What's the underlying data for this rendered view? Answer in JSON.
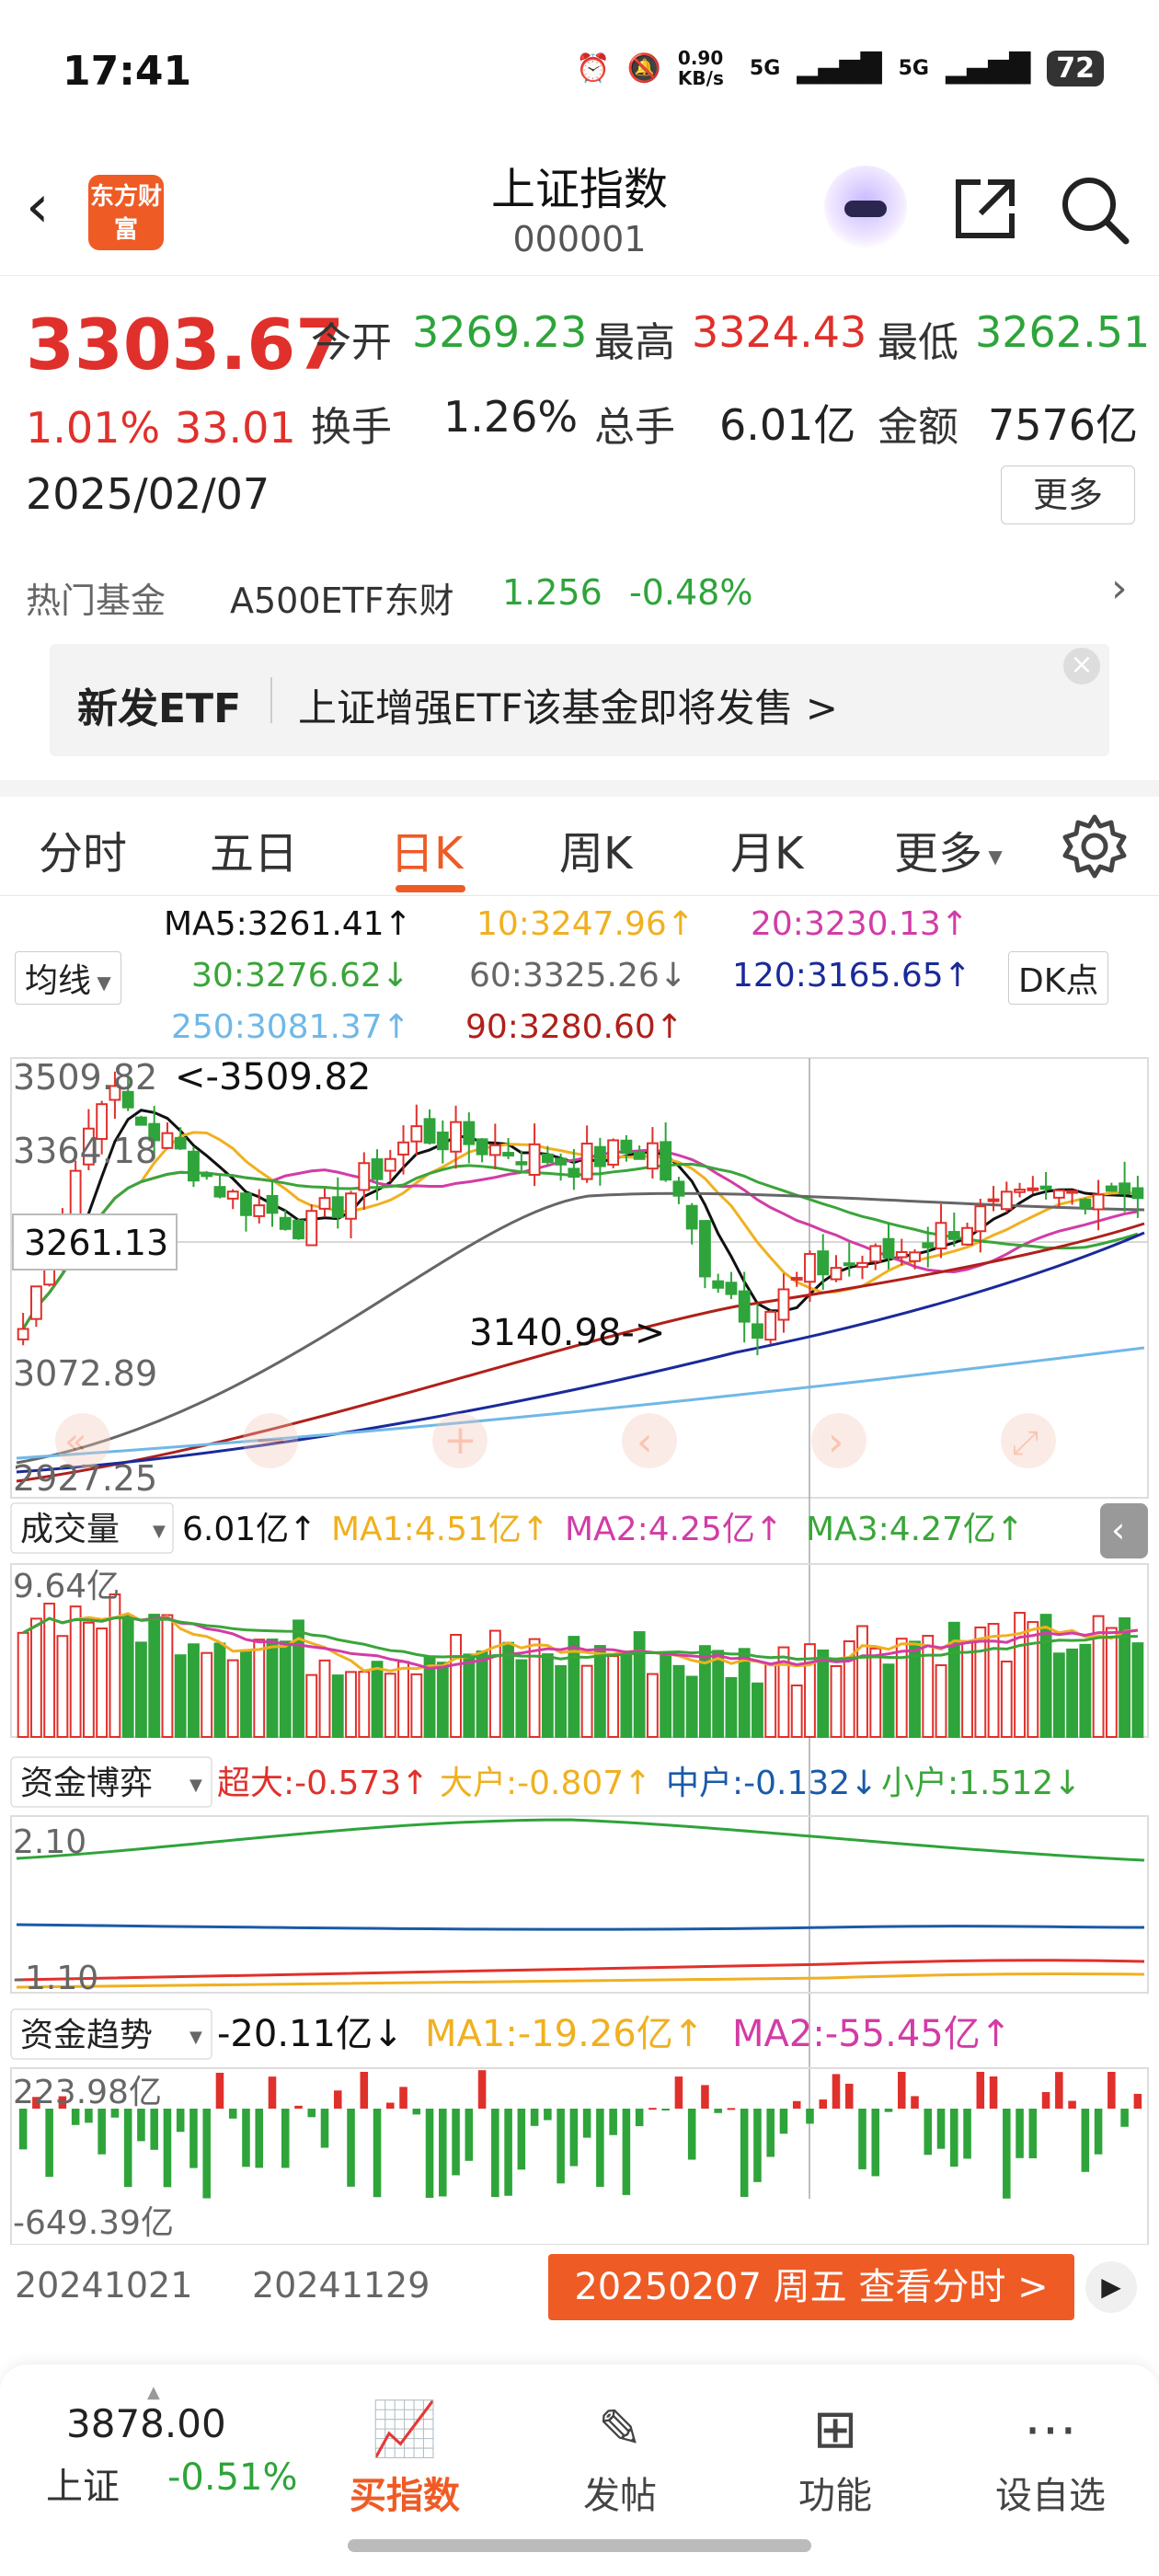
{
  "status": {
    "time": "17:41",
    "net_speed": "0.90 KB/s",
    "sig1": "5G",
    "sig2": "5G",
    "battery": "72"
  },
  "nav": {
    "logo_text": "东方财富",
    "title": "上证指数",
    "code": "000001"
  },
  "quote": {
    "price": "3303.67",
    "pct": "1.01%",
    "change": "33.01",
    "date": "2025/02/07",
    "open_label": "今开",
    "open": "3269.23",
    "high_label": "最高",
    "high": "3324.43",
    "low_label": "最低",
    "low": "3262.51",
    "turnover_label": "换手",
    "turnover": "1.26%",
    "volume_label": "总手",
    "volume": "6.01亿",
    "amount_label": "金额",
    "amount": "7576亿",
    "more_label": "更多"
  },
  "fund": {
    "label": "热门基金",
    "name": "A500ETF东财",
    "price": "1.256",
    "pct": "-0.48%"
  },
  "banner": {
    "tag": "新发ETF",
    "text": "上证增强ETF该基金即将发售  >"
  },
  "tabs": [
    {
      "label": "分时"
    },
    {
      "label": "五日"
    },
    {
      "label": "日K"
    },
    {
      "label": "周K"
    },
    {
      "label": "月K"
    },
    {
      "label": "更多"
    }
  ],
  "ma_info": {
    "selector": "均线",
    "ma5": "MA5:3261.41↑",
    "ma10": "10:3247.96↑",
    "ma20": "20:3230.13↑",
    "ma30": "30:3276.62↓",
    "ma60": "60:3325.26↓",
    "ma120": "120:3165.65↑",
    "ma250": "250:3081.37↑",
    "ma90": "90:3280.60↑",
    "dk_label": "DK点"
  },
  "kline_axis": {
    "top": "3509.82",
    "y2": "3364.18",
    "y3": "3072.89",
    "bottom": "2927.25",
    "crosshair": "3261.13",
    "high_marker": "<-3509.82",
    "low_marker": "3140.98->"
  },
  "volume_info": {
    "selector": "成交量",
    "value": "6.01亿↑",
    "ma1": "MA1:4.51亿↑",
    "ma2": "MA2:4.25亿↑",
    "ma3": "MA3:4.27亿↑",
    "axis_top": "9.64亿"
  },
  "capital_game": {
    "selector": "资金博弈",
    "super": "超大:-0.573↑",
    "large": "大户:-0.807↑",
    "mid": "中户:-0.132↓",
    "small": "小户:1.512↓",
    "axis_top": "2.10",
    "axis_bottom": "-1.10"
  },
  "capital_trend": {
    "selector": "资金趋势",
    "value": "-20.11亿↓",
    "ma1": "MA1:-19.26亿↑",
    "ma2": "MA2:-55.45亿↑",
    "axis_top": "223.98亿",
    "axis_bottom": "-649.39亿"
  },
  "date_bar": {
    "d1": "20241021",
    "d2": "20241129",
    "seek": "20250207 周五 查看分时 >"
  },
  "bottom_bar": {
    "index_value": "3878.00",
    "index_name": "上证",
    "index_pct": "-0.51%",
    "items": [
      {
        "label": "买指数"
      },
      {
        "label": "发帖"
      },
      {
        "label": "功能"
      },
      {
        "label": "设自选"
      }
    ]
  },
  "colors": {
    "up": "#e0302b",
    "down": "#2ea43a",
    "accent": "#ef5b25",
    "ma5": "#111111",
    "ma10": "#f0b020",
    "ma20": "#d23ca6",
    "ma30": "#3aa53a",
    "ma60": "#666666",
    "ma120": "#1a2a9a",
    "ma250": "#6fb8e8",
    "ma90": "#b0201a"
  }
}
